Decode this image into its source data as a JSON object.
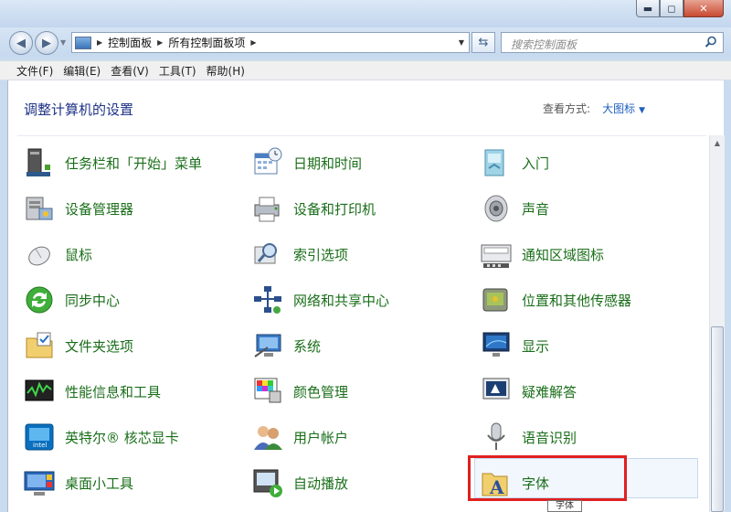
{
  "window": {
    "min_label": "▬",
    "max_label": "◻",
    "close_label": "✕"
  },
  "address": {
    "crumbs": [
      "控制面板",
      "所有控制面板项"
    ],
    "search_placeholder": "搜索控制面板"
  },
  "menu": [
    "文件(F)",
    "编辑(E)",
    "查看(V)",
    "工具(T)",
    "帮助(H)"
  ],
  "content": {
    "heading": "调整计算机的设置",
    "view_by_label": "查看方式:",
    "view_by_value": "大图标"
  },
  "items": [
    {
      "label": "任务栏和「开始」菜单",
      "icon": "taskbar-icon"
    },
    {
      "label": "日期和时间",
      "icon": "calendar-clock-icon"
    },
    {
      "label": "入门",
      "icon": "getting-started-icon"
    },
    {
      "label": "设备管理器",
      "icon": "device-manager-icon"
    },
    {
      "label": "设备和打印机",
      "icon": "printer-icon"
    },
    {
      "label": "声音",
      "icon": "speaker-icon"
    },
    {
      "label": "鼠标",
      "icon": "mouse-icon"
    },
    {
      "label": "索引选项",
      "icon": "index-search-icon"
    },
    {
      "label": "通知区域图标",
      "icon": "notification-area-icon"
    },
    {
      "label": "同步中心",
      "icon": "sync-icon"
    },
    {
      "label": "网络和共享中心",
      "icon": "network-icon"
    },
    {
      "label": "位置和其他传感器",
      "icon": "sensor-icon"
    },
    {
      "label": "文件夹选项",
      "icon": "folder-options-icon"
    },
    {
      "label": "系统",
      "icon": "system-icon"
    },
    {
      "label": "显示",
      "icon": "display-icon"
    },
    {
      "label": "性能信息和工具",
      "icon": "performance-icon"
    },
    {
      "label": "颜色管理",
      "icon": "color-management-icon"
    },
    {
      "label": "疑难解答",
      "icon": "troubleshooting-icon"
    },
    {
      "label": "英特尔® 核芯显卡",
      "icon": "intel-graphics-icon"
    },
    {
      "label": "用户帐户",
      "icon": "user-accounts-icon"
    },
    {
      "label": "语音识别",
      "icon": "microphone-icon"
    },
    {
      "label": "桌面小工具",
      "icon": "gadgets-icon"
    },
    {
      "label": "自动播放",
      "icon": "autoplay-icon"
    },
    {
      "label": "字体",
      "icon": "fonts-icon"
    }
  ],
  "tooltip": "字体",
  "colors": {
    "link_green": "#1a6e1a",
    "heading_blue": "#1e3287",
    "highlight_red": "#e02020"
  }
}
